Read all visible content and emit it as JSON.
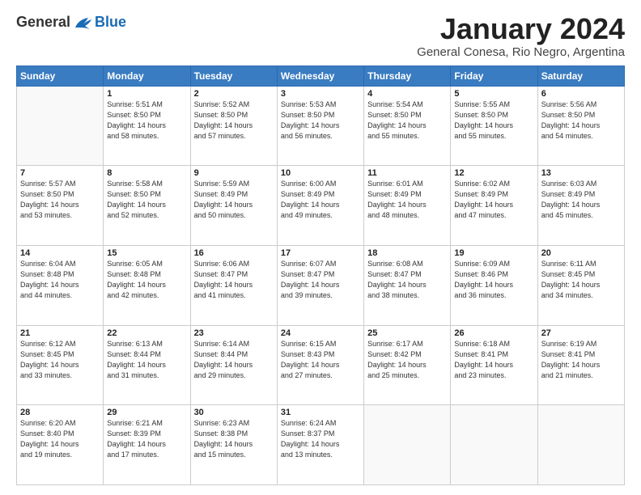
{
  "logo": {
    "general": "General",
    "blue": "Blue"
  },
  "title": "January 2024",
  "subtitle": "General Conesa, Rio Negro, Argentina",
  "header_days": [
    "Sunday",
    "Monday",
    "Tuesday",
    "Wednesday",
    "Thursday",
    "Friday",
    "Saturday"
  ],
  "weeks": [
    [
      {
        "day": "",
        "info": ""
      },
      {
        "day": "1",
        "info": "Sunrise: 5:51 AM\nSunset: 8:50 PM\nDaylight: 14 hours\nand 58 minutes."
      },
      {
        "day": "2",
        "info": "Sunrise: 5:52 AM\nSunset: 8:50 PM\nDaylight: 14 hours\nand 57 minutes."
      },
      {
        "day": "3",
        "info": "Sunrise: 5:53 AM\nSunset: 8:50 PM\nDaylight: 14 hours\nand 56 minutes."
      },
      {
        "day": "4",
        "info": "Sunrise: 5:54 AM\nSunset: 8:50 PM\nDaylight: 14 hours\nand 55 minutes."
      },
      {
        "day": "5",
        "info": "Sunrise: 5:55 AM\nSunset: 8:50 PM\nDaylight: 14 hours\nand 55 minutes."
      },
      {
        "day": "6",
        "info": "Sunrise: 5:56 AM\nSunset: 8:50 PM\nDaylight: 14 hours\nand 54 minutes."
      }
    ],
    [
      {
        "day": "7",
        "info": "Sunrise: 5:57 AM\nSunset: 8:50 PM\nDaylight: 14 hours\nand 53 minutes."
      },
      {
        "day": "8",
        "info": "Sunrise: 5:58 AM\nSunset: 8:50 PM\nDaylight: 14 hours\nand 52 minutes."
      },
      {
        "day": "9",
        "info": "Sunrise: 5:59 AM\nSunset: 8:49 PM\nDaylight: 14 hours\nand 50 minutes."
      },
      {
        "day": "10",
        "info": "Sunrise: 6:00 AM\nSunset: 8:49 PM\nDaylight: 14 hours\nand 49 minutes."
      },
      {
        "day": "11",
        "info": "Sunrise: 6:01 AM\nSunset: 8:49 PM\nDaylight: 14 hours\nand 48 minutes."
      },
      {
        "day": "12",
        "info": "Sunrise: 6:02 AM\nSunset: 8:49 PM\nDaylight: 14 hours\nand 47 minutes."
      },
      {
        "day": "13",
        "info": "Sunrise: 6:03 AM\nSunset: 8:49 PM\nDaylight: 14 hours\nand 45 minutes."
      }
    ],
    [
      {
        "day": "14",
        "info": "Sunrise: 6:04 AM\nSunset: 8:48 PM\nDaylight: 14 hours\nand 44 minutes."
      },
      {
        "day": "15",
        "info": "Sunrise: 6:05 AM\nSunset: 8:48 PM\nDaylight: 14 hours\nand 42 minutes."
      },
      {
        "day": "16",
        "info": "Sunrise: 6:06 AM\nSunset: 8:47 PM\nDaylight: 14 hours\nand 41 minutes."
      },
      {
        "day": "17",
        "info": "Sunrise: 6:07 AM\nSunset: 8:47 PM\nDaylight: 14 hours\nand 39 minutes."
      },
      {
        "day": "18",
        "info": "Sunrise: 6:08 AM\nSunset: 8:47 PM\nDaylight: 14 hours\nand 38 minutes."
      },
      {
        "day": "19",
        "info": "Sunrise: 6:09 AM\nSunset: 8:46 PM\nDaylight: 14 hours\nand 36 minutes."
      },
      {
        "day": "20",
        "info": "Sunrise: 6:11 AM\nSunset: 8:45 PM\nDaylight: 14 hours\nand 34 minutes."
      }
    ],
    [
      {
        "day": "21",
        "info": "Sunrise: 6:12 AM\nSunset: 8:45 PM\nDaylight: 14 hours\nand 33 minutes."
      },
      {
        "day": "22",
        "info": "Sunrise: 6:13 AM\nSunset: 8:44 PM\nDaylight: 14 hours\nand 31 minutes."
      },
      {
        "day": "23",
        "info": "Sunrise: 6:14 AM\nSunset: 8:44 PM\nDaylight: 14 hours\nand 29 minutes."
      },
      {
        "day": "24",
        "info": "Sunrise: 6:15 AM\nSunset: 8:43 PM\nDaylight: 14 hours\nand 27 minutes."
      },
      {
        "day": "25",
        "info": "Sunrise: 6:17 AM\nSunset: 8:42 PM\nDaylight: 14 hours\nand 25 minutes."
      },
      {
        "day": "26",
        "info": "Sunrise: 6:18 AM\nSunset: 8:41 PM\nDaylight: 14 hours\nand 23 minutes."
      },
      {
        "day": "27",
        "info": "Sunrise: 6:19 AM\nSunset: 8:41 PM\nDaylight: 14 hours\nand 21 minutes."
      }
    ],
    [
      {
        "day": "28",
        "info": "Sunrise: 6:20 AM\nSunset: 8:40 PM\nDaylight: 14 hours\nand 19 minutes."
      },
      {
        "day": "29",
        "info": "Sunrise: 6:21 AM\nSunset: 8:39 PM\nDaylight: 14 hours\nand 17 minutes."
      },
      {
        "day": "30",
        "info": "Sunrise: 6:23 AM\nSunset: 8:38 PM\nDaylight: 14 hours\nand 15 minutes."
      },
      {
        "day": "31",
        "info": "Sunrise: 6:24 AM\nSunset: 8:37 PM\nDaylight: 14 hours\nand 13 minutes."
      },
      {
        "day": "",
        "info": ""
      },
      {
        "day": "",
        "info": ""
      },
      {
        "day": "",
        "info": ""
      }
    ]
  ]
}
